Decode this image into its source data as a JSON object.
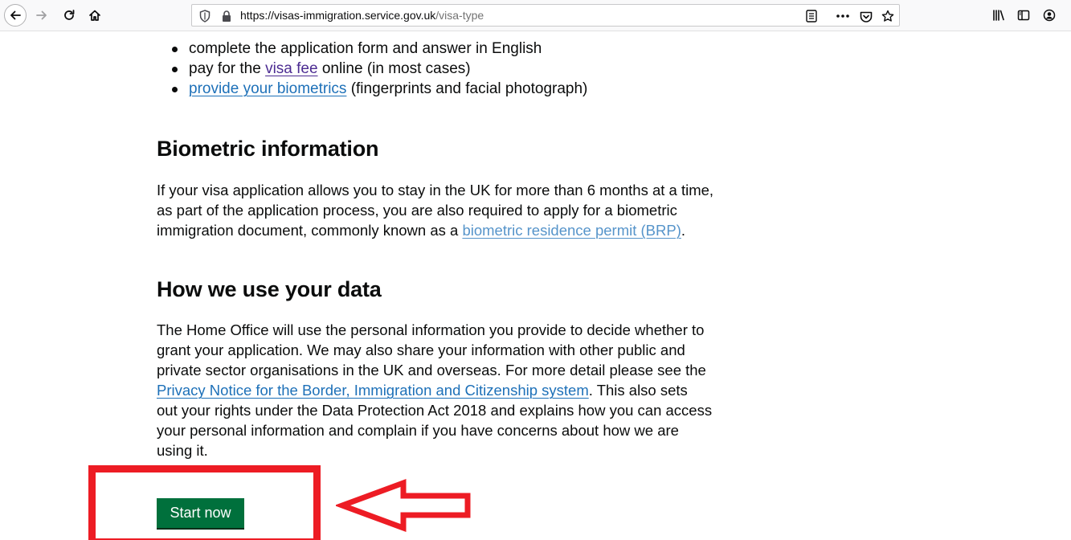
{
  "browser": {
    "url_host": "https://visas-immigration.service.gov.uk",
    "url_path": "/visa-type",
    "icons": {
      "back": "back-arrow-icon",
      "forward": "forward-arrow-icon",
      "reload": "reload-icon",
      "home": "home-icon",
      "tracking": "shield-icon",
      "secure": "lock-icon",
      "reader": "reader-view-icon",
      "more": "more-dots-icon",
      "pocket": "pocket-icon",
      "bookmark": "star-icon",
      "library": "library-icon",
      "sidebar": "sidebar-icon",
      "account": "account-icon"
    }
  },
  "bullets": {
    "item1": "complete the application form and answer in English",
    "item2_pre": "pay for the ",
    "item2_link": "visa fee",
    "item2_post": " online (in most cases)",
    "item3_link": "provide your biometrics",
    "item3_post": " (fingerprints and facial photograph)"
  },
  "biometric": {
    "heading": "Biometric information",
    "line1": "If your visa application allows you to stay in the UK for more than 6 months at a time,",
    "line2": "as part of the application process, you are also required to apply for a biometric",
    "line3_pre": "immigration document, commonly known as a ",
    "line3_link": "biometric residence permit (BRP)",
    "line3_post": "."
  },
  "data_use": {
    "heading": "How we use your data",
    "line1": "The Home Office will use the personal information you provide to decide whether to",
    "line2": "grant your application. We may also share your information with other public and",
    "line3": "private sector organisations in the UK and overseas. For more detail please see the",
    "line4_link": "Privacy Notice for the Border, Immigration and Citizenship system",
    "line4_post": ". This also sets",
    "line5": "out your rights under the Data Protection Act 2018 and explains how you can access",
    "line6": "your personal information and complain if you have concerns about how we are",
    "line7": "using it."
  },
  "start_button": {
    "label": "Start now"
  },
  "colors": {
    "link": "#1d70b8",
    "visited_link": "#4c2c92",
    "button_green": "#00703c",
    "annotation_red": "#ed1c24"
  }
}
